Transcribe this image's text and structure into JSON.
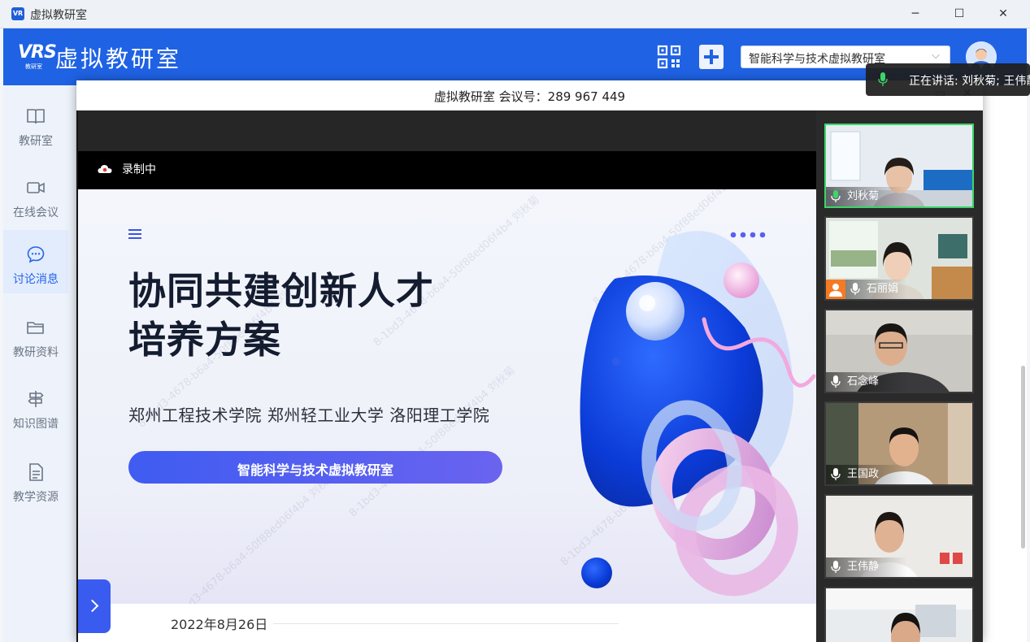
{
  "window": {
    "title": "虚拟教研室",
    "app_icon_text": "VR",
    "minimize": "─",
    "maximize": "☐",
    "close": "✕"
  },
  "header": {
    "logo_mark": "VRS",
    "logo_sub": "教研室",
    "logo_text": "虚拟教研室",
    "room_select_value": "智能科学与技术虚拟教研室",
    "room_select_chevron": "⌵"
  },
  "sidebar": {
    "items": [
      {
        "label": "教研室",
        "icon": "book-icon"
      },
      {
        "label": "在线会议",
        "icon": "video-camera-icon"
      },
      {
        "label": "讨论消息",
        "icon": "chat-bubble-icon",
        "active": true
      },
      {
        "label": "教研资料",
        "icon": "folder-icon"
      },
      {
        "label": "知识图谱",
        "icon": "signpost-icon"
      },
      {
        "label": "教学资源",
        "icon": "document-icon"
      }
    ]
  },
  "meeting": {
    "title": "虚拟教研室 会议号：289 967 449",
    "recording_text": "录制中",
    "controls": [
      "▭",
      "✕"
    ]
  },
  "slide": {
    "title_line1": "协同共建创新人才",
    "title_line2": "培养方案",
    "schools": "郑州工程技术学院  郑州轻工业大学  洛阳理工学院",
    "pill_text": "智能科学与技术虚拟教研室",
    "date": "2022年8月26日",
    "watermark": "8-1bd3-4678-b6a4-50f88ed06f4b4 刘秋菊"
  },
  "participants": [
    {
      "name": "刘秋菊",
      "speaking": true,
      "host": false
    },
    {
      "name": "石丽娟",
      "speaking": false,
      "host": true
    },
    {
      "name": "石念峰",
      "speaking": false,
      "host": false
    },
    {
      "name": "王国政",
      "speaking": false,
      "host": false
    },
    {
      "name": "王伟静",
      "speaking": false,
      "host": false
    },
    {
      "name": "",
      "speaking": false,
      "host": false
    }
  ],
  "toast": {
    "text": "正在讲话: 刘秋菊; 王伟静"
  },
  "colors": {
    "brand": "#1f62e4",
    "speaking": "#3cd568",
    "pill_start": "#3f5cf1",
    "pill_end": "#6a63f0"
  }
}
